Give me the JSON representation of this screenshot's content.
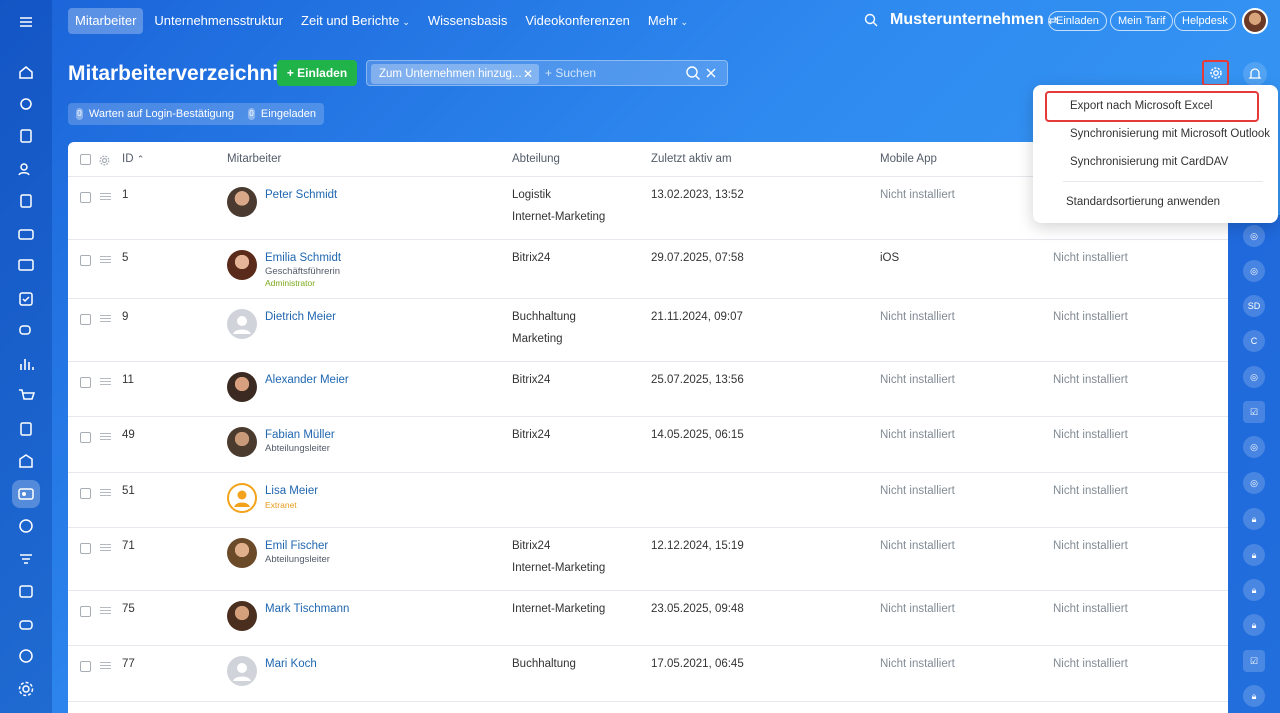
{
  "topnav": {
    "items": [
      {
        "label": "Mitarbeiter",
        "active": true
      },
      {
        "label": "Unternehmensstruktur"
      },
      {
        "label": "Zeit und Berichte",
        "caret": "⌄"
      },
      {
        "label": "Wissensbasis"
      },
      {
        "label": "Videokonferenzen"
      },
      {
        "label": "Mehr",
        "caret": "⌄"
      }
    ],
    "company": "Musterunternehmen",
    "invite": "Einladen",
    "tariff": "Mein Tarif",
    "helpdesk": "Helpdesk"
  },
  "page": {
    "title": "Mitarbeiterverzeichnis",
    "invite_button": "+ Einladen",
    "filter_chip": "Zum Unternehmen hinzug...",
    "search_placeholder": "+ Suchen",
    "counters": [
      {
        "count": "0",
        "label": "Warten auf Login-Bestätigung"
      },
      {
        "count": "0",
        "label": "Eingeladen"
      }
    ]
  },
  "table": {
    "headers": {
      "id": "ID",
      "sort": "⌃",
      "employee": "Mitarbeiter",
      "department": "Abteilung",
      "last_active": "Zuletzt aktiv am",
      "mobile": "Mobile App"
    },
    "rows": [
      {
        "id": "1",
        "name": "Peter Schmidt",
        "role": "",
        "tag": "",
        "dept1": "Logistik",
        "dept2": "Internet-Marketing",
        "last": "13.02.2023, 13:52",
        "mobile": "Nicht installiert",
        "desktop": ""
      },
      {
        "id": "5",
        "name": "Emilia Schmidt",
        "role": "Geschäftsführerin",
        "tag": "Administrator",
        "dept1": "Bitrix24",
        "dept2": "",
        "last": "29.07.2025, 07:58",
        "mobile": "iOS",
        "desktop": "Nicht installiert"
      },
      {
        "id": "9",
        "name": "Dietrich Meier",
        "role": "",
        "tag": "",
        "dept1": "Buchhaltung",
        "dept2": "Marketing",
        "last": "21.11.2024, 09:07",
        "mobile": "Nicht installiert",
        "desktop": "Nicht installiert"
      },
      {
        "id": "11",
        "name": "Alexander Meier",
        "role": "",
        "tag": "",
        "dept1": "Bitrix24",
        "dept2": "",
        "last": "25.07.2025, 13:56",
        "mobile": "Nicht installiert",
        "desktop": "Nicht installiert"
      },
      {
        "id": "49",
        "name": "Fabian Müller",
        "role": "Abteilungsleiter",
        "tag": "",
        "dept1": "Bitrix24",
        "dept2": "",
        "last": "14.05.2025, 06:15",
        "mobile": "Nicht installiert",
        "desktop": "Nicht installiert"
      },
      {
        "id": "51",
        "name": "Lisa Meier",
        "role": "",
        "tag": "Extranet",
        "dept1": "",
        "dept2": "",
        "last": "",
        "mobile": "Nicht installiert",
        "desktop": "Nicht installiert"
      },
      {
        "id": "71",
        "name": "Emil Fischer",
        "role": "Abteilungsleiter",
        "tag": "",
        "dept1": "Bitrix24",
        "dept2": "Internet-Marketing",
        "last": "12.12.2024, 15:19",
        "mobile": "Nicht installiert",
        "desktop": "Nicht installiert"
      },
      {
        "id": "75",
        "name": "Mark Tischmann",
        "role": "",
        "tag": "",
        "dept1": "Internet-Marketing",
        "dept2": "",
        "last": "23.05.2025, 09:48",
        "mobile": "Nicht installiert",
        "desktop": "Nicht installiert"
      },
      {
        "id": "77",
        "name": "Mari Koch",
        "role": "",
        "tag": "",
        "dept1": "Buchhaltung",
        "dept2": "",
        "last": "17.05.2021, 06:45",
        "mobile": "Nicht installiert",
        "desktop": "Nicht installiert"
      }
    ]
  },
  "menu": {
    "items": [
      "Export nach Microsoft Excel",
      "Synchronisierung mit Microsoft Outlook",
      "Synchronisierung mit CardDAV",
      "Standardsortierung anwenden"
    ]
  },
  "rightrail": {
    "sd": "SD",
    "c": "C"
  },
  "colors": {
    "accent": "#2067b0",
    "invite_green": "#1fb34a",
    "highlight": "#e53a3a"
  }
}
